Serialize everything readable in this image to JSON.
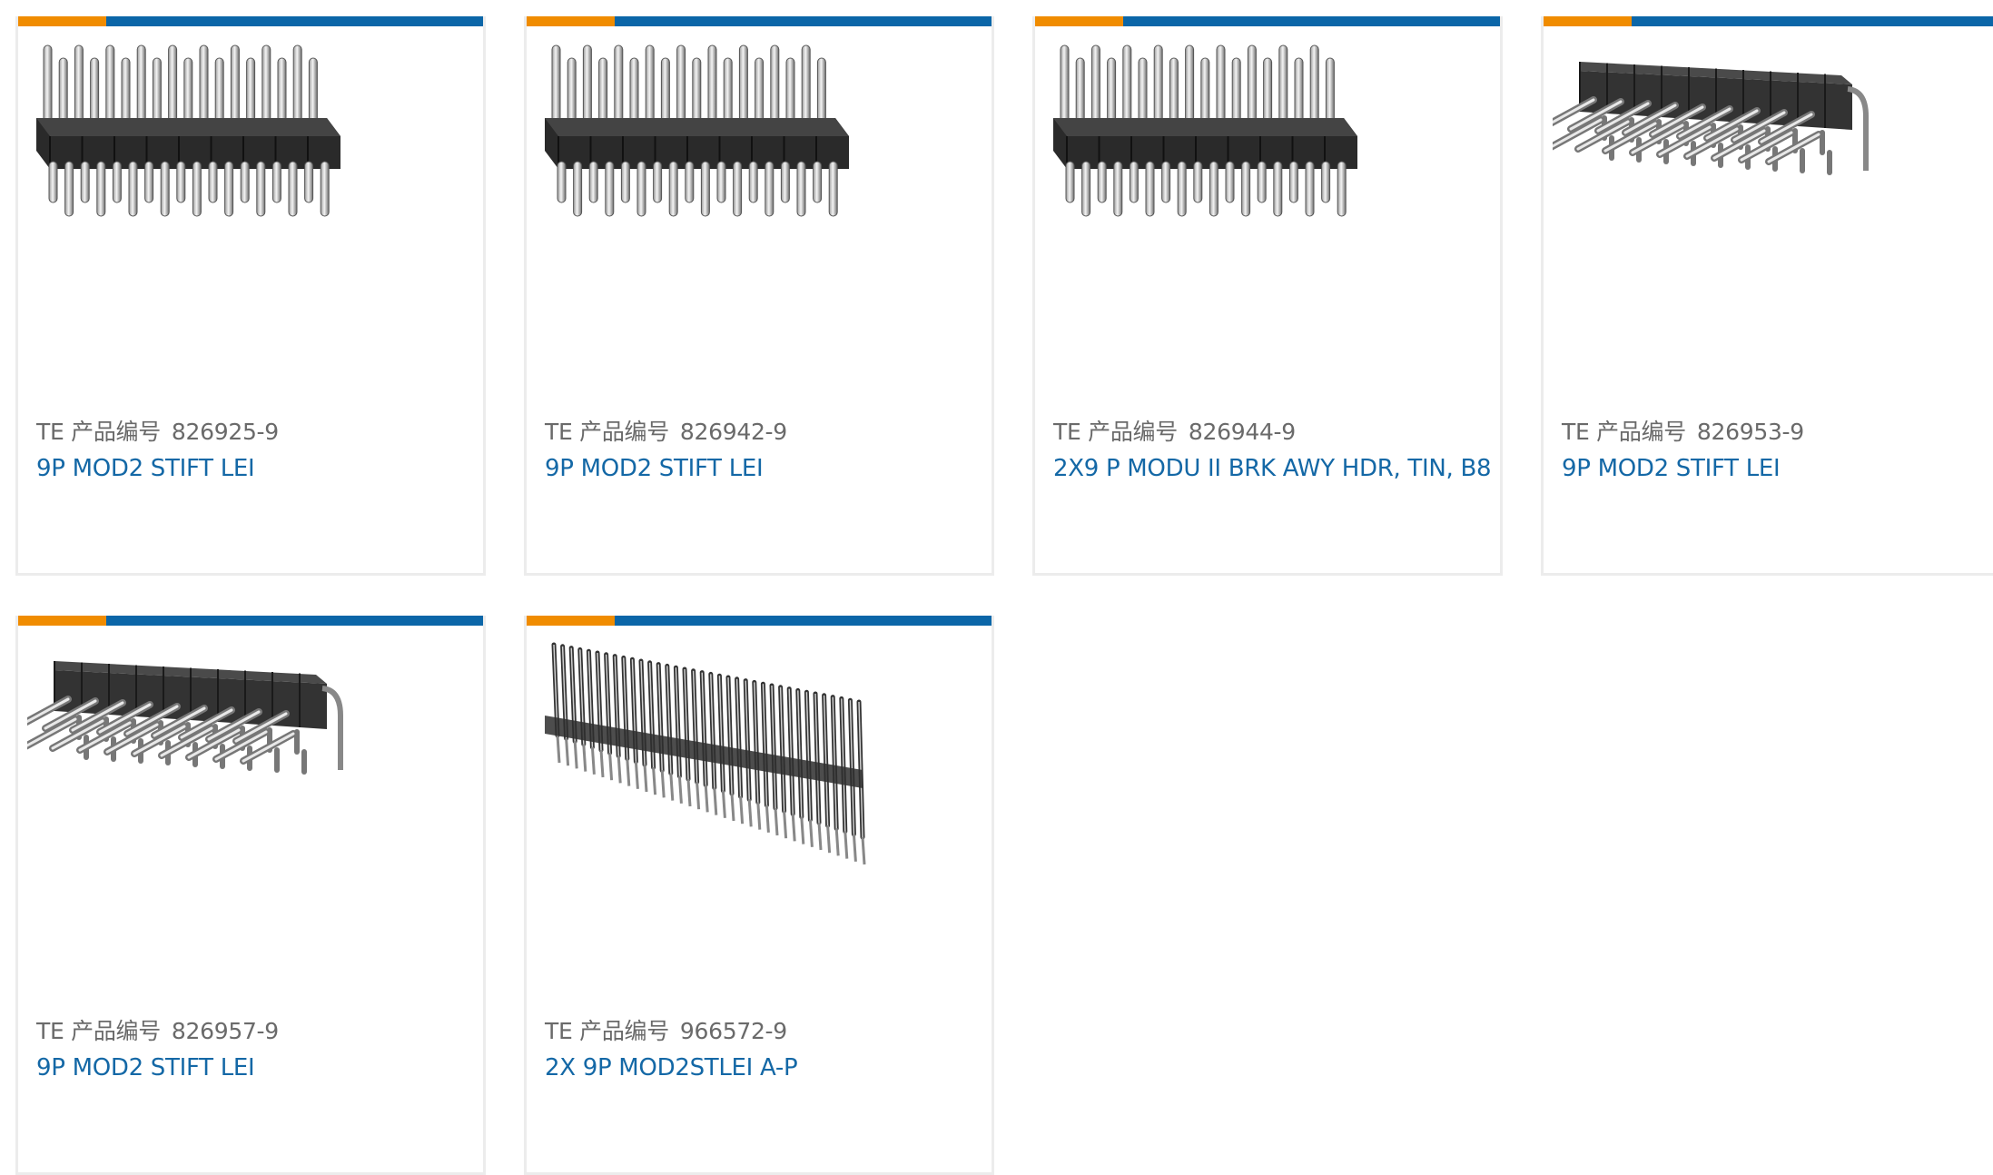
{
  "colors": {
    "accent_orange": "#f08c00",
    "accent_blue": "#0b66a8",
    "link_blue": "#1468a6",
    "label_gray": "#6a6a6a",
    "card_border": "#ececec"
  },
  "products": [
    {
      "part_label": "TE 产品编号",
      "part_number": "826925-9",
      "description": "9P MOD2 STIFT LEI",
      "image_icon": "straight-pin-header-image"
    },
    {
      "part_label": "TE 产品编号",
      "part_number": "826942-9",
      "description": "9P MOD2 STIFT LEI",
      "image_icon": "straight-pin-header-image"
    },
    {
      "part_label": "TE 产品编号",
      "part_number": "826944-9",
      "description": "2X9 P MODU II BRK AWY HDR, TIN, B8",
      "image_icon": "straight-pin-header-image"
    },
    {
      "part_label": "TE 产品编号",
      "part_number": "826953-9",
      "description": "9P MOD2 STIFT LEI",
      "image_icon": "right-angle-pin-header-image"
    },
    {
      "part_label": "TE 产品编号",
      "part_number": "826957-9",
      "description": "9P MOD2 STIFT LEI",
      "image_icon": "right-angle-pin-header-image"
    },
    {
      "part_label": "TE 产品编号",
      "part_number": "966572-9",
      "description": "2X 9P MOD2STLEI A-P",
      "image_icon": "long-pin-header-image"
    }
  ]
}
